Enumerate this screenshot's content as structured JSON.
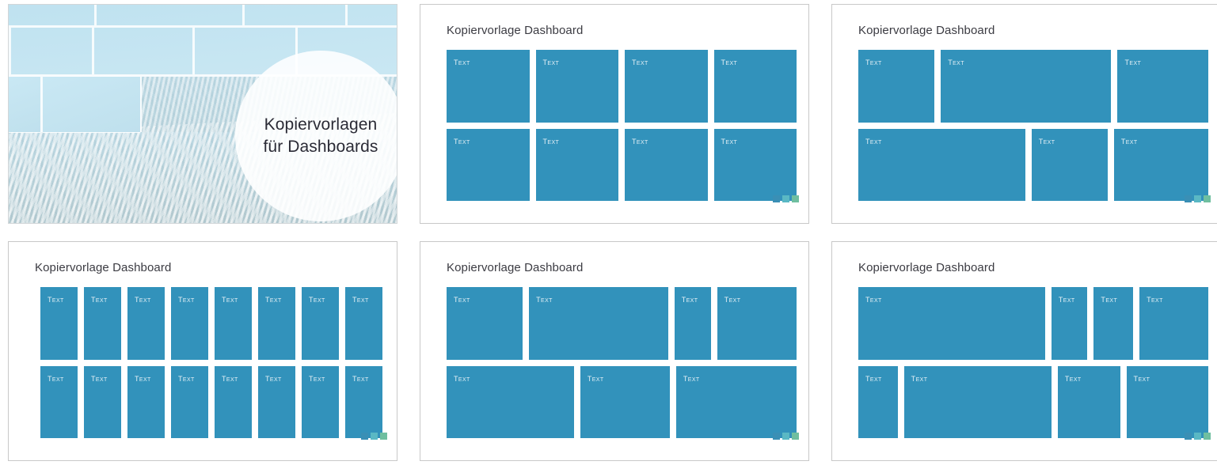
{
  "colors": {
    "tile": "#3292bb",
    "tile_label": "#e4f0f6",
    "card_border": "#c8c8c8",
    "title_text": "#3b3b42",
    "cover_bg": "#c5e5f2",
    "deco_1": "#3a8fb5",
    "deco_2": "#5ab8c4",
    "deco_3": "#6fbfa0"
  },
  "cover": {
    "title": "Kopiervorlagen\nfür Dashboards"
  },
  "tile_label": "Text",
  "cards": [
    {
      "title": "Kopiervorlage Dashboard",
      "rows": [
        {
          "spans": [
            1,
            1,
            1,
            1
          ]
        },
        {
          "spans": [
            1,
            1,
            1,
            1
          ]
        }
      ]
    },
    {
      "title": "Kopiervorlage Dashboard",
      "rows": [
        {
          "spans": [
            21,
            47,
            25
          ]
        },
        {
          "spans": [
            46,
            21,
            26
          ]
        }
      ]
    },
    {
      "title": "Kopiervorlage Dashboard",
      "rows": [
        {
          "spans": [
            1,
            1,
            1,
            1,
            1,
            1,
            1,
            1
          ]
        },
        {
          "spans": [
            1,
            1,
            1,
            1,
            1,
            1,
            1,
            1
          ]
        }
      ]
    },
    {
      "title": "Kopiervorlage Dashboard",
      "rows": [
        {
          "spans": [
            23,
            42,
            11,
            24
          ]
        },
        {
          "spans": [
            37,
            26,
            35
          ]
        }
      ]
    },
    {
      "title": "Kopiervorlage Dashboard",
      "rows": [
        {
          "spans": [
            57,
            11,
            12,
            21
          ]
        },
        {
          "spans": [
            12,
            45,
            19,
            25
          ]
        }
      ]
    }
  ],
  "deco_squares": [
    "deco_1",
    "deco_2",
    "deco_3"
  ]
}
